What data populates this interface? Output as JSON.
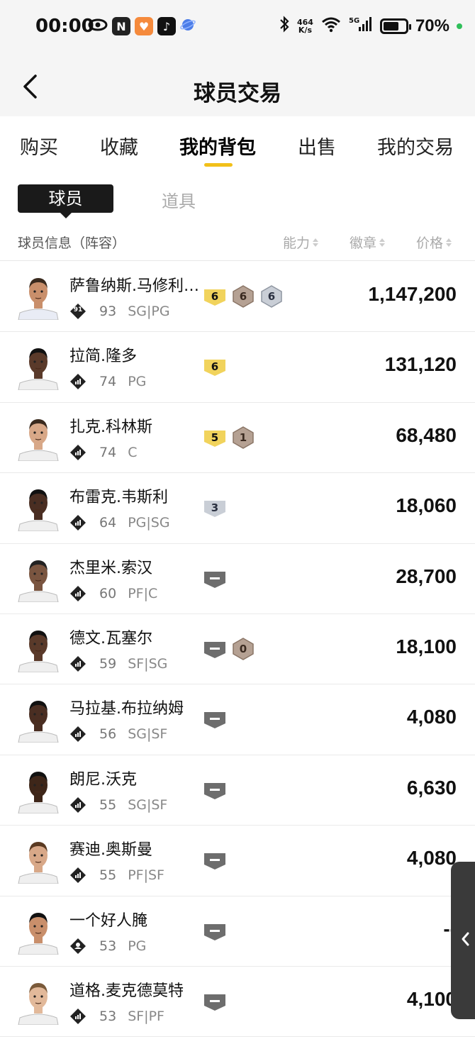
{
  "status": {
    "time": "00:00",
    "speed_top": "464",
    "speed_bottom": "K/s",
    "battery": "70%",
    "battery_level": 0.7
  },
  "nav": {
    "title": "球员交易"
  },
  "tabs": [
    {
      "label": "购买"
    },
    {
      "label": "收藏"
    },
    {
      "label": "我的背包",
      "active": true
    },
    {
      "label": "出售"
    },
    {
      "label": "我的交易"
    }
  ],
  "subtabs": {
    "active": "球员",
    "other": "道具"
  },
  "columns": {
    "info": "球员信息（阵容）",
    "ability": "能力",
    "badge": "徽章",
    "price": "价格"
  },
  "players": [
    {
      "name": "萨鲁纳斯.马修利…",
      "tier_label": "91",
      "rating": "93",
      "pos": "SG|PG",
      "price": "1,147,200",
      "badges": [
        {
          "type": "gold",
          "label": "6"
        },
        {
          "type": "bronze",
          "label": "6"
        },
        {
          "type": "silver",
          "label": "6"
        }
      ],
      "tier": "special"
    },
    {
      "name": "拉简.隆多",
      "rating": "74",
      "pos": "PG",
      "price": "131,120",
      "badges": [
        {
          "type": "gold",
          "label": "6"
        }
      ],
      "tier": "bars"
    },
    {
      "name": "扎克.科林斯",
      "rating": "74",
      "pos": "C",
      "price": "68,480",
      "badges": [
        {
          "type": "gold",
          "label": "5"
        },
        {
          "type": "bronze",
          "label": "1"
        }
      ],
      "tier": "bars"
    },
    {
      "name": "布雷克.韦斯利",
      "rating": "64",
      "pos": "PG|SG",
      "price": "18,060",
      "badges": [
        {
          "type": "silver",
          "label": "3"
        }
      ],
      "tier": "bars"
    },
    {
      "name": "杰里米.索汉",
      "rating": "60",
      "pos": "PF|C",
      "price": "28,700",
      "badges": [
        {
          "type": "none",
          "label": ""
        }
      ],
      "tier": "bars"
    },
    {
      "name": "德文.瓦塞尔",
      "rating": "59",
      "pos": "SF|SG",
      "price": "18,100",
      "badges": [
        {
          "type": "none",
          "label": ""
        },
        {
          "type": "bronze",
          "label": "0"
        }
      ],
      "tier": "bars"
    },
    {
      "name": "马拉基.布拉纳姆",
      "rating": "56",
      "pos": "SG|SF",
      "price": "4,080",
      "badges": [
        {
          "type": "none",
          "label": ""
        }
      ],
      "tier": "bars"
    },
    {
      "name": "朗尼.沃克",
      "rating": "55",
      "pos": "SG|SF",
      "price": "6,630",
      "badges": [
        {
          "type": "none",
          "label": ""
        }
      ],
      "tier": "bars"
    },
    {
      "name": "赛迪.奥斯曼",
      "rating": "55",
      "pos": "PF|SF",
      "price": "4,080",
      "badges": [
        {
          "type": "none",
          "label": ""
        }
      ],
      "tier": "bars"
    },
    {
      "name": "一个好人腌",
      "rating": "53",
      "pos": "PG",
      "price": "--",
      "badges": [
        {
          "type": "none",
          "label": ""
        }
      ],
      "tier": "person"
    },
    {
      "name": "道格.麦克德莫特",
      "rating": "53",
      "pos": "SF|PF",
      "price": "4,100",
      "badges": [
        {
          "type": "none",
          "label": ""
        }
      ],
      "tier": "bars"
    }
  ],
  "colors": {
    "accent": "#f2c019",
    "gold": "#f1d35c",
    "bronze": "#b5a193",
    "silver": "#c9ced6",
    "none": "#6d6d6d"
  }
}
